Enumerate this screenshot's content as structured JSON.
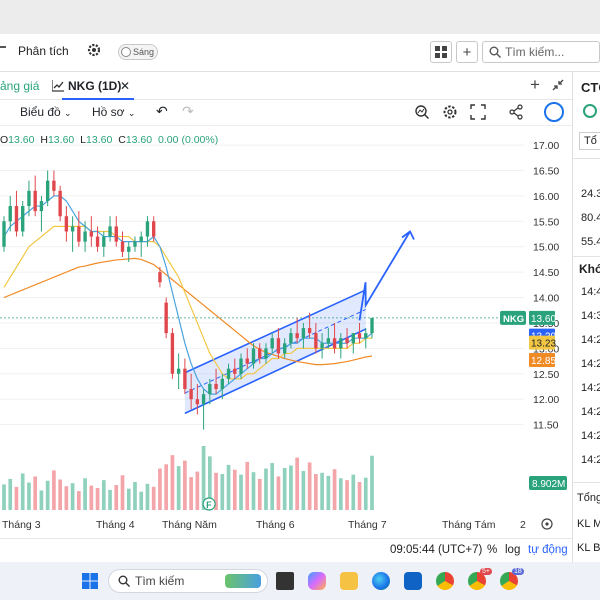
{
  "toolbar": {
    "analysis_label": "Phân tích",
    "theme_toggle_label": "Sáng",
    "search_placeholder": "Tìm kiếm..."
  },
  "tabs": {
    "left_tab_partial": "ảng giá",
    "active_tab": "NKG (1D)",
    "close_symbol": "✕",
    "plus_symbol": "+"
  },
  "chart_toolbar": {
    "chart_menu": "Biểu đồ",
    "profile_menu": "Hồ sơ"
  },
  "ohlc": {
    "o_label": "O",
    "o_value": "13.60",
    "h_label": "H",
    "h_value": "13.60",
    "l_label": "L",
    "l_value": "13.60",
    "c_label": "C",
    "c_value": "13.60",
    "change": "0.00",
    "change_pct": "(0.00%)"
  },
  "bottom_bar": {
    "time": "09:05:44 (UTC+7)",
    "percent": "%",
    "log": "log",
    "auto": "tự động"
  },
  "right_panel": {
    "title_partial": "CTC",
    "button_partial": "Tổ",
    "values": [
      "24.3",
      "80.4",
      "55.4"
    ],
    "section_partial": "Khớ",
    "times": [
      "14:4",
      "14:3",
      "14:2",
      "14:2",
      "14:2",
      "14:2",
      "14:2",
      "14:2"
    ],
    "total_partial": "Tổng",
    "kl_m_partial": "KL M",
    "kl_b_partial": "KL B"
  },
  "taskbar": {
    "search_placeholder": "Tìm kiếm",
    "badge_count_1": "5+",
    "badge_count_2": "18"
  },
  "colors": {
    "up": "#2aa37c",
    "down": "#e0474c",
    "accent": "#2962ff",
    "ma_blue": "#4aa3df",
    "ma_yellow": "#f2c744",
    "ma_orange": "#f08a24",
    "vol_up": "#8fd1bd",
    "vol_down": "#f3a5a9"
  },
  "chart_data": {
    "type": "candlestick",
    "symbol": "NKG",
    "interval": "1D",
    "y_ticks": [
      17.0,
      16.5,
      16.0,
      15.5,
      15.0,
      14.5,
      14.0,
      13.5,
      13.0,
      12.5,
      12.0,
      11.5
    ],
    "ylim": [
      11.0,
      17.1
    ],
    "x_labels": [
      "Tháng 3",
      "Tháng 4",
      "Tháng Năm",
      "Tháng 6",
      "Tháng 7",
      "Tháng Tám",
      "2"
    ],
    "price_tags": [
      {
        "label": "NKG",
        "value": "13.60",
        "color": "#2aa37c"
      },
      {
        "value": "13.29",
        "color": "#2962ff"
      },
      {
        "value": "13.23",
        "color": "#f2c744"
      },
      {
        "value": "12.85",
        "color": "#f08a24"
      }
    ],
    "volume_label": "8.902M",
    "candles": [
      [
        15.0,
        15.6,
        14.9,
        15.5
      ],
      [
        15.5,
        16.0,
        15.3,
        15.8
      ],
      [
        15.8,
        16.1,
        15.2,
        15.3
      ],
      [
        15.3,
        15.9,
        15.2,
        15.8
      ],
      [
        15.8,
        16.3,
        15.6,
        16.1
      ],
      [
        16.1,
        16.4,
        15.6,
        15.7
      ],
      [
        15.7,
        16.0,
        15.3,
        15.9
      ],
      [
        15.9,
        16.5,
        15.8,
        16.3
      ],
      [
        16.3,
        16.5,
        16.0,
        16.1
      ],
      [
        16.1,
        16.2,
        15.5,
        15.6
      ],
      [
        15.6,
        15.8,
        15.1,
        15.3
      ],
      [
        15.3,
        15.6,
        14.9,
        15.4
      ],
      [
        15.4,
        15.7,
        15.0,
        15.1
      ],
      [
        15.1,
        15.5,
        14.9,
        15.3
      ],
      [
        15.3,
        15.6,
        15.0,
        15.2
      ],
      [
        15.2,
        15.4,
        14.9,
        15.0
      ],
      [
        15.0,
        15.3,
        14.8,
        15.2
      ],
      [
        15.2,
        15.6,
        15.1,
        15.4
      ],
      [
        15.4,
        15.6,
        15.0,
        15.1
      ],
      [
        15.1,
        15.3,
        14.8,
        14.9
      ],
      [
        14.9,
        15.1,
        14.7,
        15.0
      ],
      [
        15.0,
        15.2,
        14.9,
        15.1
      ],
      [
        15.1,
        15.3,
        14.8,
        15.2
      ],
      [
        15.2,
        15.6,
        15.0,
        15.5
      ],
      [
        15.5,
        15.6,
        15.1,
        15.2
      ],
      [
        14.5,
        14.6,
        14.2,
        14.3
      ],
      [
        13.9,
        14.0,
        13.2,
        13.3
      ],
      [
        13.3,
        13.4,
        12.4,
        12.5
      ],
      [
        12.5,
        12.9,
        12.2,
        12.6
      ],
      [
        12.6,
        12.8,
        12.1,
        12.2
      ],
      [
        12.2,
        12.5,
        11.8,
        12.0
      ],
      [
        12.0,
        12.3,
        11.7,
        11.9
      ],
      [
        11.9,
        12.2,
        11.4,
        12.1
      ],
      [
        12.1,
        12.4,
        11.9,
        12.3
      ],
      [
        12.3,
        12.6,
        12.1,
        12.2
      ],
      [
        12.2,
        12.5,
        12.0,
        12.4
      ],
      [
        12.4,
        12.7,
        12.3,
        12.6
      ],
      [
        12.6,
        12.8,
        12.4,
        12.5
      ],
      [
        12.5,
        12.9,
        12.4,
        12.8
      ],
      [
        12.8,
        13.0,
        12.6,
        12.7
      ],
      [
        12.7,
        13.1,
        12.6,
        13.0
      ],
      [
        13.0,
        13.1,
        12.7,
        12.8
      ],
      [
        12.8,
        13.1,
        12.7,
        13.0
      ],
      [
        13.0,
        13.3,
        12.9,
        13.2
      ],
      [
        13.2,
        13.4,
        12.8,
        12.9
      ],
      [
        12.9,
        13.2,
        12.8,
        13.1
      ],
      [
        13.1,
        13.4,
        13.0,
        13.3
      ],
      [
        13.3,
        13.6,
        13.1,
        13.2
      ],
      [
        13.2,
        13.5,
        13.0,
        13.4
      ],
      [
        13.4,
        13.7,
        13.2,
        13.3
      ],
      [
        13.3,
        13.5,
        12.9,
        13.0
      ],
      [
        13.0,
        13.3,
        12.8,
        13.1
      ],
      [
        13.1,
        13.4,
        13.0,
        13.2
      ],
      [
        13.2,
        13.5,
        12.9,
        13.0
      ],
      [
        13.0,
        13.3,
        12.8,
        13.2
      ],
      [
        13.2,
        13.4,
        13.0,
        13.1
      ],
      [
        13.1,
        13.3,
        12.9,
        13.3
      ],
      [
        13.3,
        13.5,
        13.1,
        13.2
      ],
      [
        13.2,
        13.4,
        13.0,
        13.3
      ],
      [
        13.3,
        13.6,
        13.2,
        13.6
      ]
    ],
    "ma_fast": [
      15.2,
      15.4,
      15.5,
      15.6,
      15.7,
      15.8,
      15.8,
      15.9,
      16.0,
      16.0,
      15.9,
      15.7,
      15.5,
      15.4,
      15.3,
      15.3,
      15.2,
      15.2,
      15.2,
      15.1,
      15.1,
      15.1,
      15.1,
      15.1,
      15.2,
      15.0,
      14.6,
      14.1,
      13.6,
      13.1,
      12.7,
      12.4,
      12.2,
      12.1,
      12.1,
      12.2,
      12.3,
      12.4,
      12.5,
      12.6,
      12.7,
      12.8,
      12.8,
      12.9,
      13.0,
      13.0,
      13.1,
      13.1,
      13.2,
      13.2,
      13.2,
      13.1,
      13.1,
      13.1,
      13.1,
      13.1,
      13.2,
      13.2,
      13.2,
      13.3
    ],
    "ma_mid": [
      14.2,
      14.4,
      14.6,
      14.8,
      15.0,
      15.1,
      15.2,
      15.3,
      15.4,
      15.4,
      15.4,
      15.4,
      15.4,
      15.4,
      15.3,
      15.3,
      15.3,
      15.3,
      15.2,
      15.2,
      15.2,
      15.1,
      15.1,
      15.1,
      15.1,
      15.0,
      14.8,
      14.6,
      14.4,
      14.1,
      13.8,
      13.5,
      13.2,
      12.9,
      12.7,
      12.5,
      12.4,
      12.4,
      12.4,
      12.5,
      12.5,
      12.6,
      12.7,
      12.8,
      12.8,
      12.9,
      12.9,
      13.0,
      13.0,
      13.0,
      13.0,
      13.0,
      13.0,
      13.0,
      13.0,
      13.0,
      13.1,
      13.1,
      13.2,
      13.2
    ],
    "ma_slow": [
      14.0,
      14.05,
      14.1,
      14.15,
      14.2,
      14.25,
      14.3,
      14.35,
      14.4,
      14.45,
      14.5,
      14.55,
      14.6,
      14.62,
      14.65,
      14.68,
      14.7,
      14.72,
      14.74,
      14.75,
      14.76,
      14.77,
      14.75,
      14.7,
      14.65,
      14.55,
      14.45,
      14.35,
      14.25,
      14.15,
      14.05,
      13.95,
      13.85,
      13.75,
      13.65,
      13.55,
      13.45,
      13.35,
      13.25,
      13.15,
      13.05,
      12.98,
      12.92,
      12.88,
      12.84,
      12.8,
      12.77,
      12.74,
      12.72,
      12.7,
      12.68,
      12.68,
      12.69,
      12.7,
      12.72,
      12.74,
      12.77,
      12.8,
      12.83,
      12.85
    ],
    "volume": [
      4.2,
      5.1,
      3.8,
      6.0,
      4.5,
      5.5,
      3.2,
      4.8,
      6.5,
      5.0,
      3.9,
      4.4,
      3.1,
      5.2,
      4.0,
      3.6,
      4.9,
      3.3,
      4.1,
      5.7,
      3.5,
      4.6,
      3.0,
      4.3,
      3.8,
      6.8,
      7.5,
      9.0,
      7.2,
      8.1,
      5.4,
      6.3,
      10.5,
      8.8,
      6.1,
      5.9,
      7.4,
      6.6,
      5.8,
      7.9,
      6.2,
      5.1,
      6.8,
      7.7,
      5.5,
      6.9,
      7.3,
      8.6,
      6.4,
      7.8,
      5.9,
      6.1,
      5.6,
      6.7,
      5.2,
      4.9,
      5.8,
      4.6,
      5.3,
      8.902
    ]
  }
}
